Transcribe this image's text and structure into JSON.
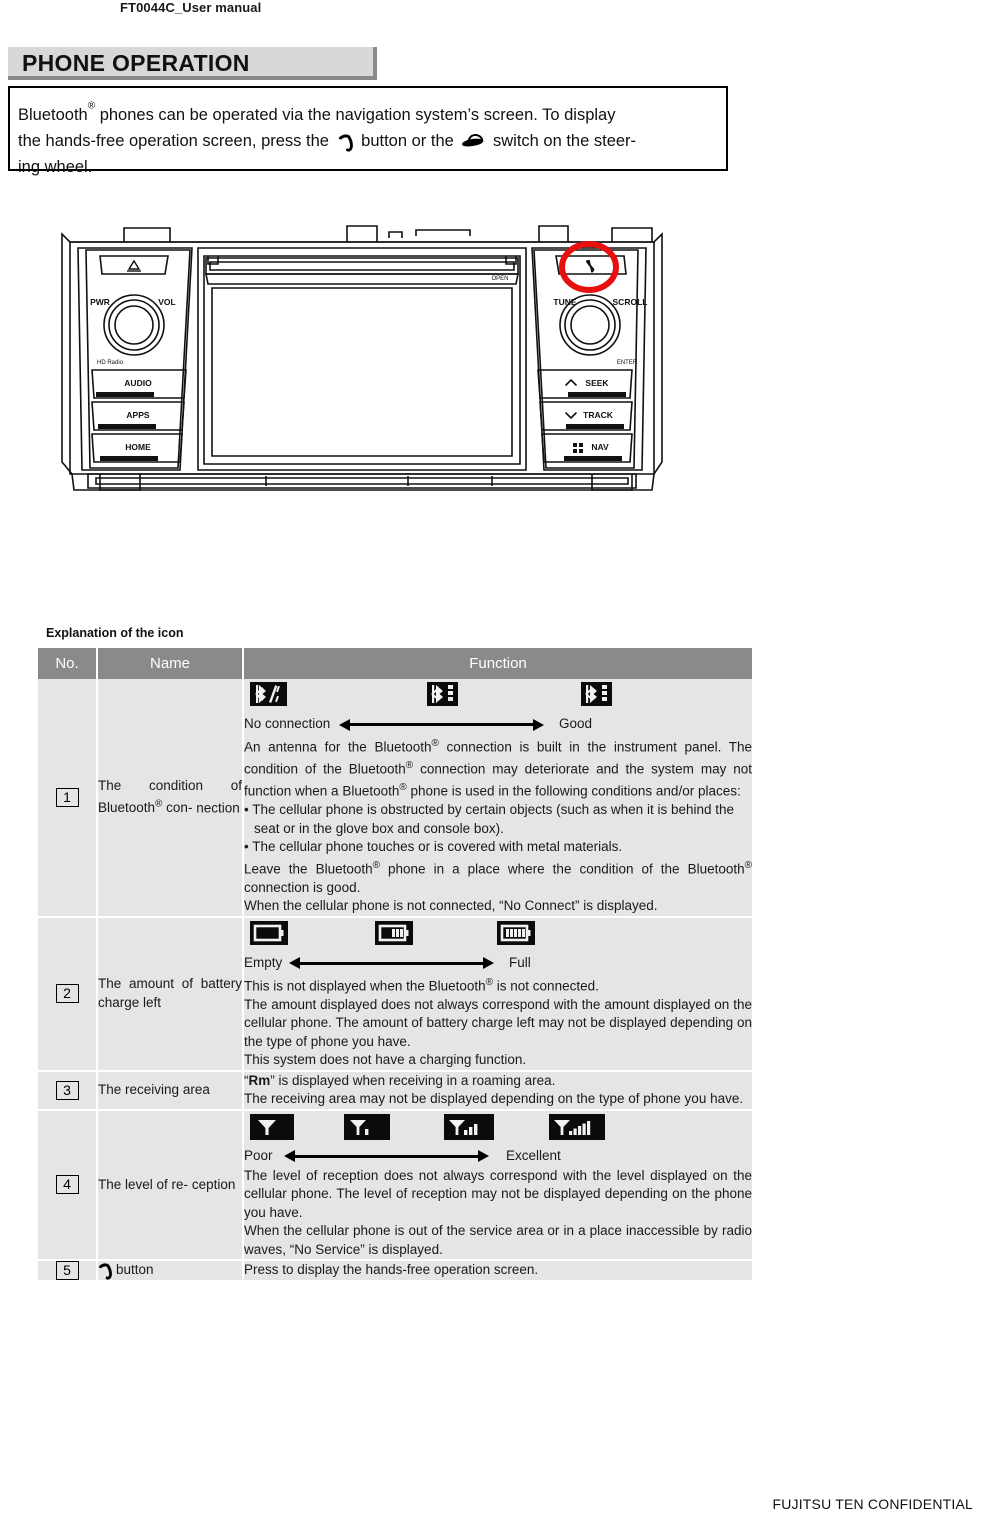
{
  "document": {
    "header": "FT0044C_User manual",
    "footer": "FUJITSU TEN CONFIDENTIAL"
  },
  "section": {
    "title": "PHONE OPERATION"
  },
  "intro": {
    "line1_a": "Bluetooth",
    "line1_reg": "®",
    "line1_b": " phones can be operated via the navigation system’s screen. To display",
    "line2_a": "the hands-free operation screen, press the",
    "line2_b": "button or the",
    "line2_c": "switch on the steer-",
    "line3": "ing wheel."
  },
  "device": {
    "labels": {
      "eject": "△",
      "pwr": "PWR",
      "vol": "VOL",
      "hd_radio": "HD Radio",
      "audio": "AUDIO",
      "apps": "APPS",
      "home": "HOME",
      "tune": "TUNE",
      "scroll": "SCROLL",
      "seek": "SEEK",
      "track": "TRACK",
      "nav": "NAV",
      "open": "OPEN",
      "enter": "ENTER"
    },
    "callout_color": "#e8100f"
  },
  "explanation_label": "Explanation of the icon",
  "table": {
    "headers": {
      "no": "No.",
      "name": "Name",
      "function": "Function"
    },
    "rows": [
      {
        "no": "1",
        "name_lines": [
          "The condition of",
          "Bluetooth® con-",
          "nection"
        ],
        "name_plain": "The condition of Bluetooth® connection",
        "icons": {
          "type": "bluetooth",
          "items": [
            "no-connection",
            "medium",
            "good"
          ]
        },
        "scale": {
          "left": "No connection",
          "right": "Good"
        },
        "paragraphs": [
          "An antenna for the Bluetooth® connection is built in the instrument panel. The condition of the Bluetooth® connection may deteriorate and the system may not function when a Bluetooth® phone is used in the following conditions and/or places:",
          "• The cellular phone is obstructed by certain objects (such as when it is behind the seat or in the glove box and console box).",
          "• The cellular phone touches or is covered with metal materials.",
          "Leave the Bluetooth® phone in a place where the condition of the Bluetooth® connection is good.",
          "When the cellular phone is not connected, “No Connect” is displayed."
        ]
      },
      {
        "no": "2",
        "name_lines": [
          "The amount of",
          "battery charge",
          "left"
        ],
        "name_plain": "The amount of battery charge left",
        "icons": {
          "type": "battery",
          "items": [
            "empty",
            "half",
            "full"
          ]
        },
        "scale": {
          "left": "Empty",
          "right": "Full"
        },
        "paragraphs": [
          "This is not displayed when the Bluetooth® is not connected.",
          "The amount displayed does not always correspond with the amount displayed on the cellular phone. The amount of battery charge left may not be displayed depending on the type of phone you have.",
          "This system does not have a charging function."
        ]
      },
      {
        "no": "3",
        "name_lines": [
          "The receiving",
          "area"
        ],
        "name_plain": "The receiving area",
        "icons": null,
        "scale": null,
        "paragraphs": [
          "“Rm” is displayed when receiving in a roaming area.",
          "The receiving area may not be displayed depending on the type of phone you have."
        ],
        "bold_lead": "Rm"
      },
      {
        "no": "4",
        "name_lines": [
          "The level of re-",
          "ception"
        ],
        "name_plain": "The level of reception",
        "icons": {
          "type": "antenna",
          "items": [
            "level0",
            "level1",
            "level3",
            "level5"
          ]
        },
        "scale": {
          "left": "Poor",
          "right": "Excellent"
        },
        "paragraphs": [
          "The level of reception does not always correspond with the level displayed on the cellular phone. The level of reception may not be displayed depending on the phone you have.",
          "When the cellular phone is out of the service area or in a place inaccessible by radio waves, “No Service” is displayed."
        ]
      },
      {
        "no": "5",
        "name_lines": [
          "button"
        ],
        "name_plain": "button",
        "name_icon": "handset-icon",
        "icons": null,
        "scale": null,
        "paragraphs": [
          "Press to display the hands-free operation screen."
        ]
      }
    ]
  }
}
